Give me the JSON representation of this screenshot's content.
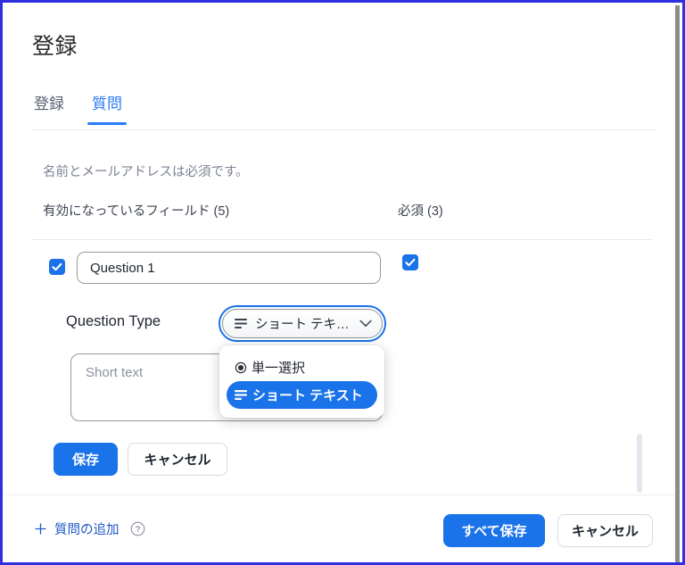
{
  "window": {
    "title": "登録",
    "border_color": "#2f2fe0"
  },
  "tabs": [
    {
      "label": "登録",
      "active": false
    },
    {
      "label": "質問",
      "active": true
    }
  ],
  "form": {
    "helper_text": "名前とメールアドレスは必須です。",
    "column_headers": {
      "enabled": "有効になっているフィールド (5)",
      "required": "必須 (3)"
    },
    "question": {
      "enabled_checked": true,
      "required_checked": true,
      "title_value": "Question 1",
      "title_placeholder": "Question 1",
      "type_label": "Question Type",
      "type_value": "ショート テキ…",
      "type_icon": "short-text-icon",
      "chevron_icon": "chevron-down-icon",
      "preview_placeholder": "Short text"
    },
    "dropdown": {
      "open": true,
      "items": [
        {
          "label": "単一選択",
          "icon": "radio-button-icon",
          "selected": false
        },
        {
          "label": "ショート テキスト",
          "icon": "short-text-icon",
          "selected": true
        }
      ]
    },
    "row_actions": {
      "save_label": "保存",
      "cancel_label": "キャンセル"
    }
  },
  "footer": {
    "add_question_label": "質問の追加",
    "add_icon": "plus-icon",
    "help_icon": "question-mark-circle-icon",
    "save_all_label": "すべて保存",
    "cancel_label": "キャンセル"
  },
  "colors": {
    "accent": "#1a73e8",
    "tab_active": "#2b7cf5",
    "link": "#2159c8",
    "frame": "#2f2fe0"
  }
}
